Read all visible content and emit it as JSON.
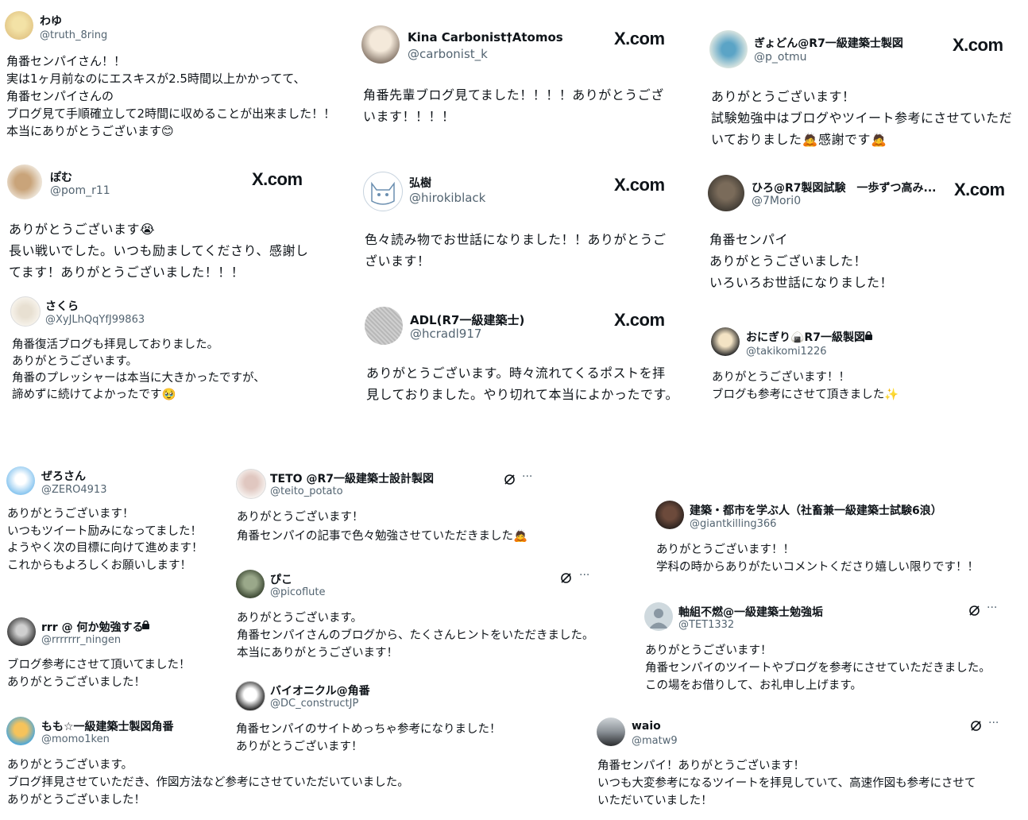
{
  "x_brand": "X.com",
  "tweets": [
    {
      "name": "わゆ",
      "handle": "@truth_8ring",
      "text": "角番センパイさん！！\n実は1ヶ月前なのにエスキスが2.5時間以上かかってて、\n角番センパイさんの\nブログ見て手順確立して2時間に収めることが出来ました！！\n本当にありがとうございます😊"
    },
    {
      "name": "Kina Carbonist†Atomos",
      "handle": "@carbonist_k",
      "text": "角番先輩ブログ見てました！！！！ありがとうござ\nいます！！！！"
    },
    {
      "name": "ぎょどん@R7一級建築士製図",
      "handle": "@p_otmu",
      "text": "ありがとうございます！\n試験勉強中はブログやツイート参考にさせていただ\nいておりました🙇感謝です🙇"
    },
    {
      "name": "ぽむ",
      "handle": "@pom_r11",
      "text": "ありがとうございます😭\n長い戦いでした。いつも励ましてくださり、感謝し\nてます！ありがとうございました！！！"
    },
    {
      "name": "弘樹",
      "handle": "@hirokiblack",
      "text": "色々読み物でお世話になりました！！ありがとうご\nざいます！"
    },
    {
      "name": "ひろ@R7製図試験　一歩ずつ高み...",
      "handle": "@7Mori0",
      "text": "角番センパイ\nありがとうございました！\nいろいろお世話になりました！"
    },
    {
      "name": "さくら",
      "handle": "@XyJLhQqYfJ99863",
      "text": "角番復活ブログも拝見しておりました。\nありがとうございます。\n角番のプレッシャーは本当に大きかったですが、\n諦めずに続けてよかったです🥹"
    },
    {
      "name": "ADL(R7一級建築士)",
      "handle": "@hcradl917",
      "text": "ありがとうございます。時々流れてくるポストを拝\n見しておりました。やり切れて本当によかったです。"
    },
    {
      "name": "おにぎり🍙R7一級製図",
      "handle": "@takikomi1226",
      "text": "ありがとうございます！！\nブログも参考にさせて頂きました✨"
    },
    {
      "name": "ぜろさん",
      "handle": "@ZERO4913",
      "text": "ありがとうございます！\nいつもツイート励みになってました！\nようやく次の目標に向けて進めます！\nこれからもよろしくお願いします！"
    },
    {
      "name": "TETO @R7一級建築士設計製図",
      "handle": "@teito_potato",
      "text": "ありがとうございます！\n角番センパイの記事で色々勉強させていただきました🙇"
    },
    {
      "name": "建築・都市を学ぶ人（社畜兼一級建築士試験6浪）",
      "handle": "@giantkilling366",
      "text": "ありがとうございます！！\n学科の時からありがたいコメントくださり嬉しい限りです！！"
    },
    {
      "name": "ぴこ",
      "handle": "@picoflute",
      "text": "ありがとうございます。\n角番センパイさんのブログから、たくさんヒントをいただきました。\n本当にありがとうございます！"
    },
    {
      "name": "軸組不燃@一級建築士勉強垢",
      "handle": "@TET1332",
      "text": "ありがとうございます！\n角番センパイのツイートやブログを参考にさせていただきました。\nこの場をお借りして、お礼申し上げます。"
    },
    {
      "name": "rrr @ 何か勉強する",
      "handle": "@rrrrrrr_ningen",
      "text": "ブログ参考にさせて頂いてました！\nありがとうございました！"
    },
    {
      "name": "バイオニクル@角番",
      "handle": "@DC_constructJP",
      "text": "角番センパイのサイトめっちゃ参考になりました！\nありがとうございます！"
    },
    {
      "name": "もも☆一級建築士製図角番",
      "handle": "@momo1ken",
      "text": "ありがとうございます。\nブログ拝見させていただき、作図方法など参考にさせていただいていました。\nありがとうございました！"
    },
    {
      "name": "waio",
      "handle": "@matw9",
      "text": "角番センパイ！ありがとうございます！\nいつも大変参考になるツイートを拝見していて、高速作図も参考にさせて\nいただいていました！"
    }
  ],
  "colors": {
    "text": "#0f1419",
    "muted": "#536471"
  },
  "icons": {
    "more": "more-icon",
    "grok": "grok-icon",
    "lock": "lock-icon"
  }
}
